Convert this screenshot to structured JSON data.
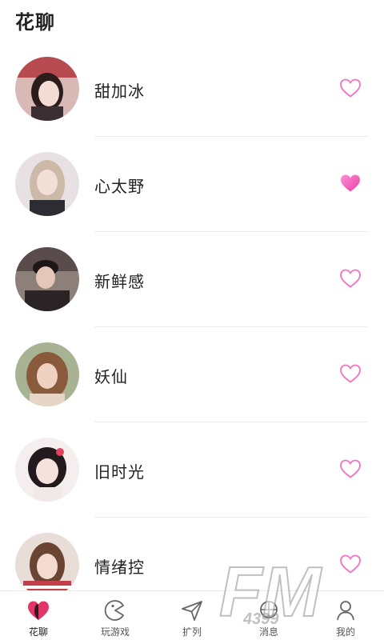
{
  "header": {
    "title": "花聊"
  },
  "list": {
    "items": [
      {
        "name": "甜加冰",
        "liked": false
      },
      {
        "name": "心太野",
        "liked": true
      },
      {
        "name": "新鲜感",
        "liked": false
      },
      {
        "name": "妖仙",
        "liked": false
      },
      {
        "name": "旧时光",
        "liked": false
      },
      {
        "name": "情绪控",
        "liked": false
      }
    ]
  },
  "tabbar": {
    "tabs": [
      {
        "label": "花聊",
        "icon": "heart-icon",
        "active": true
      },
      {
        "label": "玩游戏",
        "icon": "game-icon",
        "active": false
      },
      {
        "label": "扩列",
        "icon": "send-icon",
        "active": false
      },
      {
        "label": "消息",
        "icon": "message-icon",
        "active": false
      },
      {
        "label": "我的",
        "icon": "profile-icon",
        "active": false
      }
    ]
  },
  "watermark": {
    "text": "FM",
    "subtext": "4399"
  },
  "colors": {
    "accent": "#f472c4",
    "liked_fill": "#f25bbd",
    "text": "#222222",
    "divider": "#ececec"
  }
}
